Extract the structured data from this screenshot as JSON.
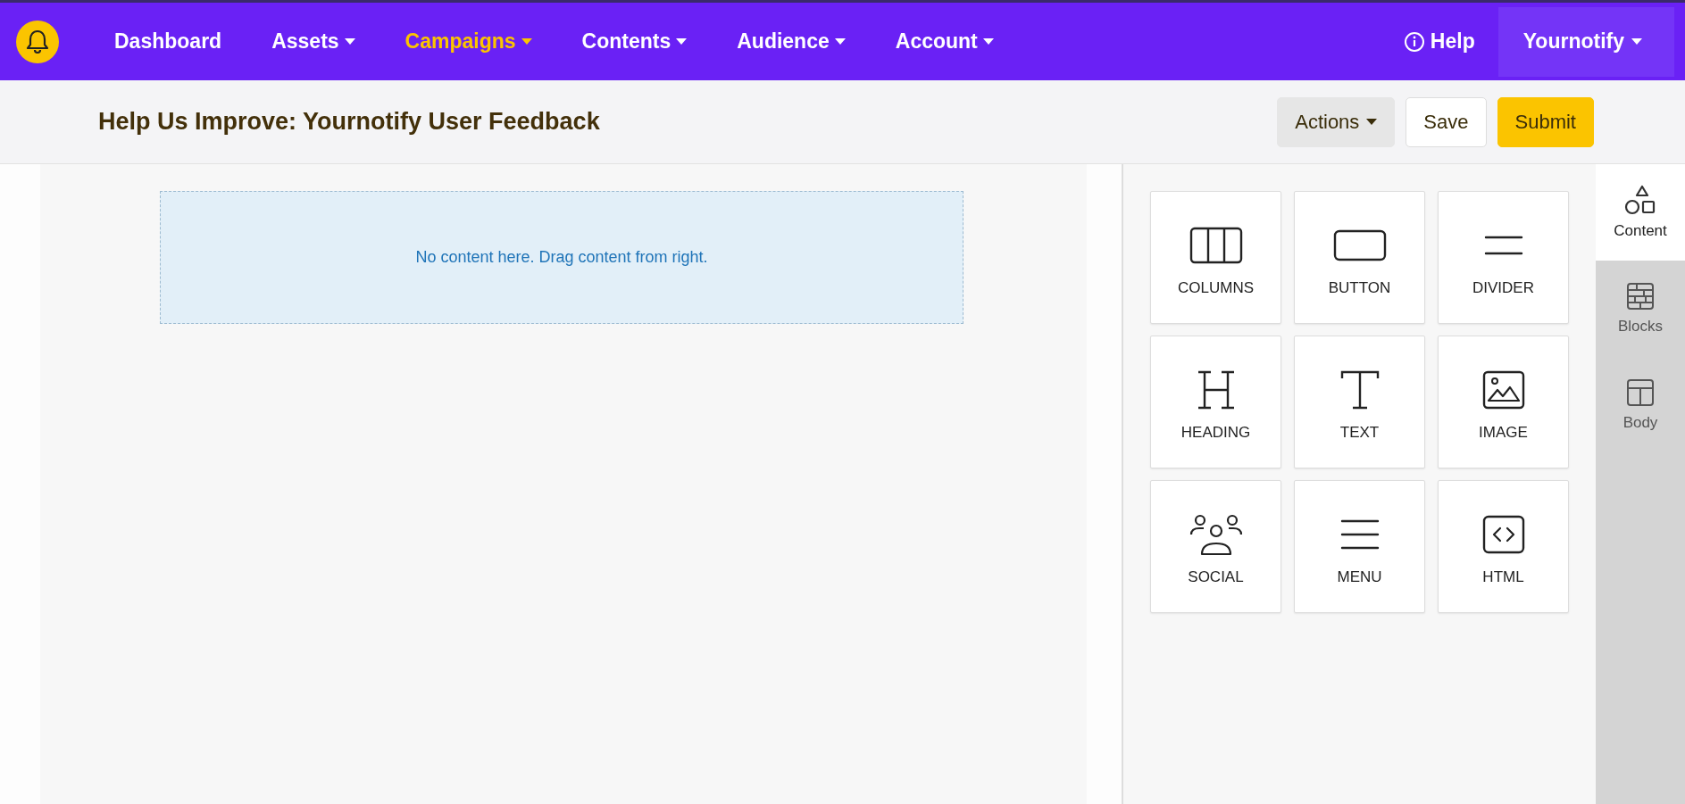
{
  "nav": {
    "items": [
      {
        "label": "Dashboard",
        "has_menu": false,
        "selected": false
      },
      {
        "label": "Assets",
        "has_menu": true,
        "selected": false
      },
      {
        "label": "Campaigns",
        "has_menu": true,
        "selected": true
      },
      {
        "label": "Contents",
        "has_menu": true,
        "selected": false
      },
      {
        "label": "Audience",
        "has_menu": true,
        "selected": false
      },
      {
        "label": "Account",
        "has_menu": true,
        "selected": false
      }
    ],
    "help": "Help",
    "account": "Yournotify"
  },
  "header": {
    "title": "Help Us Improve: Yournotify User Feedback",
    "actions": "Actions",
    "save": "Save",
    "submit": "Submit"
  },
  "canvas": {
    "empty_message": "No content here. Drag content from right."
  },
  "tiles": [
    {
      "kind": "columns",
      "label": "COLUMNS"
    },
    {
      "kind": "button",
      "label": "BUTTON"
    },
    {
      "kind": "divider",
      "label": "DIVIDER"
    },
    {
      "kind": "heading",
      "label": "HEADING"
    },
    {
      "kind": "text",
      "label": "TEXT"
    },
    {
      "kind": "image",
      "label": "IMAGE"
    },
    {
      "kind": "social",
      "label": "SOCIAL"
    },
    {
      "kind": "menu",
      "label": "MENU"
    },
    {
      "kind": "html",
      "label": "HTML"
    }
  ],
  "side_tabs": [
    {
      "kind": "content",
      "label": "Content",
      "selected": true
    },
    {
      "kind": "blocks",
      "label": "Blocks",
      "selected": false
    },
    {
      "kind": "body",
      "label": "Body",
      "selected": false
    }
  ]
}
